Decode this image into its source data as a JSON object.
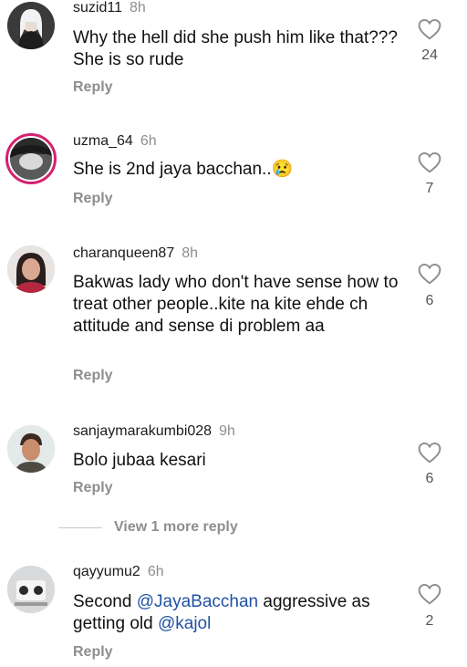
{
  "comments": [
    {
      "username": "suzid11",
      "time": "8h",
      "text": "Why the hell did she push him like that??? She is so rude",
      "likes": "24",
      "reply": "Reply"
    },
    {
      "username": "uzma_64",
      "time": "6h",
      "text": "She is 2nd jaya bacchan..",
      "emoji": "😢",
      "likes": "7",
      "reply": "Reply"
    },
    {
      "username": "charanqueen87",
      "time": "8h",
      "text": "Bakwas lady who don't have sense how to treat other people..kite na kite ehde ch attitude and sense di problem aa",
      "likes": "6",
      "reply": "Reply"
    },
    {
      "username": "sanjaymarakumbi028",
      "time": "9h",
      "text": "Bolo jubaa kesari",
      "likes": "6",
      "reply": "Reply"
    },
    {
      "username": "qayyumu2",
      "time": "6h",
      "text_parts": [
        "Second ",
        "@JayaBacchan",
        " aggressive as getting old ",
        "@kajol"
      ],
      "likes": "2",
      "reply": "Reply"
    }
  ],
  "view_more": "View 1 more reply",
  "icons": {
    "like": "heart-outline-icon"
  },
  "colors": {
    "mention": "#2152a3",
    "muted": "#8e8e8e",
    "story_ring": "#d3226e"
  }
}
